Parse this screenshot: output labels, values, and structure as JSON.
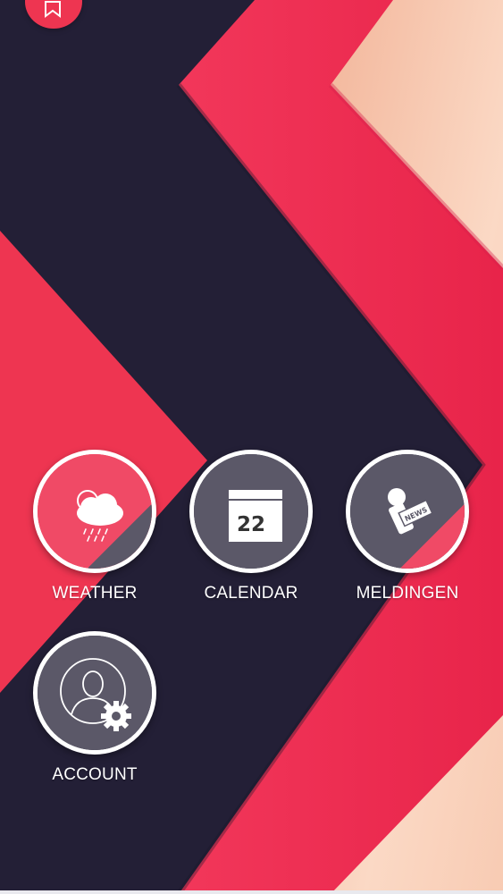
{
  "colors": {
    "navy": "#231f36",
    "crimson": "#ee3551",
    "peach": "#f6c2a5",
    "tile_gray": "#5b5868",
    "tile_pink": "#f04a66"
  },
  "top_button": {
    "icon": "bookmark-icon"
  },
  "tiles": [
    {
      "label": "WEATHER",
      "icon": "weather-cloud-rain-icon"
    },
    {
      "label": "CALENDAR",
      "icon": "calendar-icon",
      "day": "22"
    },
    {
      "label": "MELDINGEN",
      "icon": "news-microphone-icon",
      "badge": "NEWS"
    },
    {
      "label": "ACCOUNT",
      "icon": "user-settings-icon"
    }
  ]
}
